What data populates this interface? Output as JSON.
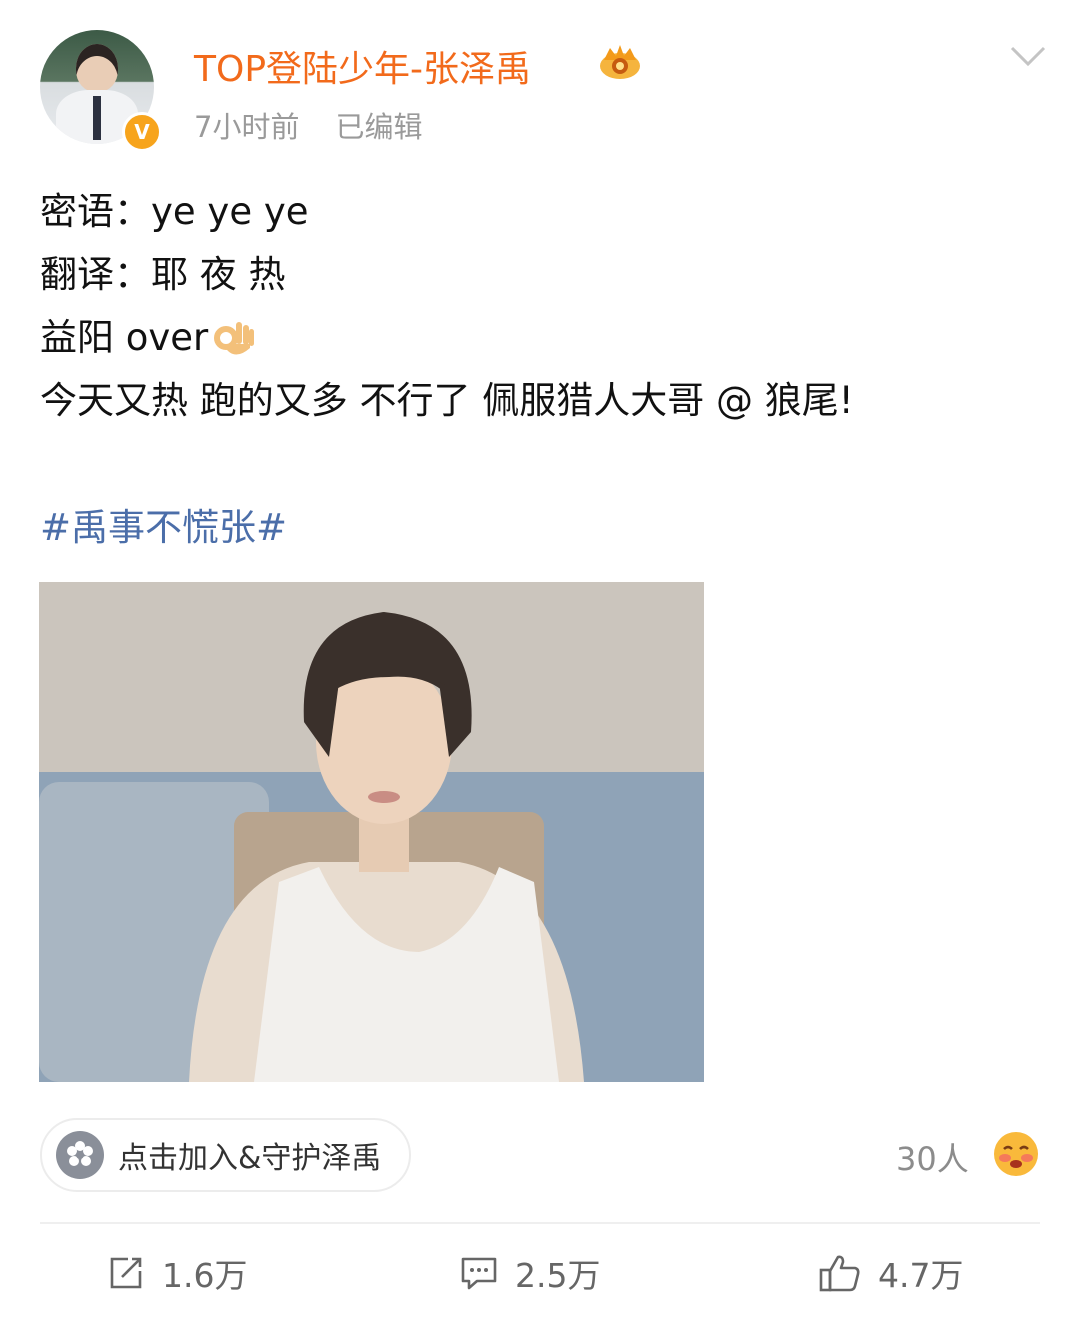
{
  "post": {
    "username": "TOP登陆少年-张泽禹",
    "verified_badge": "V",
    "time_ago": "7小时前",
    "edited": "已编辑",
    "lines": [
      "密语：ye ye ye",
      "翻译：耶 夜 热",
      "益阳 over",
      "今天又热 跑的又多 不行了 佩服猎人大哥 @ 狼尾!"
    ],
    "hashtag": "#禹事不慌张#",
    "icons": [
      "crown-badge-icon",
      "chevron-down-icon",
      "ok-hand-emoji-icon"
    ]
  },
  "fan_group": {
    "join_label": "点击加入&守护泽禹",
    "reaction_count": "30人"
  },
  "actions": {
    "repost_count": "1.6万",
    "comment_count": "2.5万",
    "like_count": "4.7万"
  },
  "colors": {
    "username": "#f26a1b",
    "hashtag": "#4b6ea9",
    "verified": "#f7a41c"
  }
}
